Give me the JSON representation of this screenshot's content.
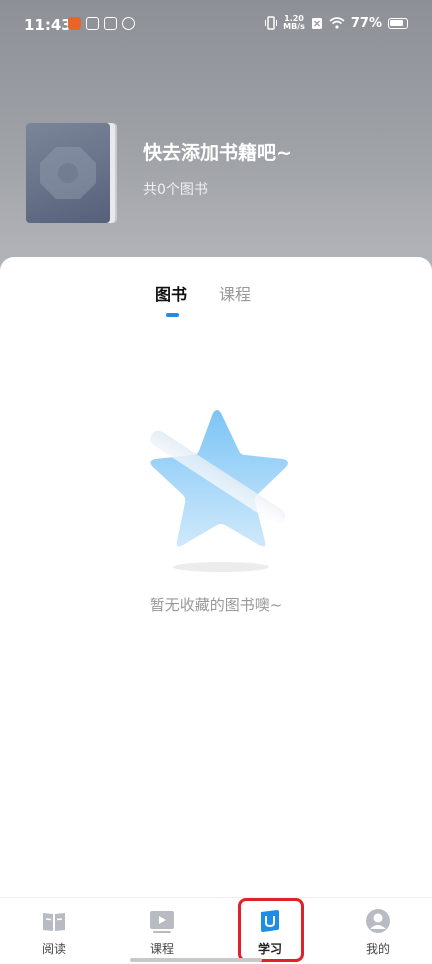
{
  "status_bar": {
    "time": "11:43",
    "network_speed_value": "1.20",
    "network_speed_unit": "MB/s",
    "battery": "77%"
  },
  "header": {
    "title": "快去添加书籍吧~",
    "count_text": "共0个图书"
  },
  "tabs": [
    {
      "label": "图书",
      "active": true
    },
    {
      "label": "课程",
      "active": false
    }
  ],
  "empty_state": {
    "message": "暂无收藏的图书噢~",
    "icon": "star-icon"
  },
  "bottom_nav": [
    {
      "label": "阅读",
      "icon": "book-icon",
      "active": false
    },
    {
      "label": "课程",
      "icon": "play-icon",
      "active": false
    },
    {
      "label": "学习",
      "icon": "study-icon",
      "active": true
    },
    {
      "label": "我的",
      "icon": "profile-icon",
      "active": false
    }
  ],
  "colors": {
    "accent": "#1e8de8",
    "highlight": "#e0202a"
  }
}
